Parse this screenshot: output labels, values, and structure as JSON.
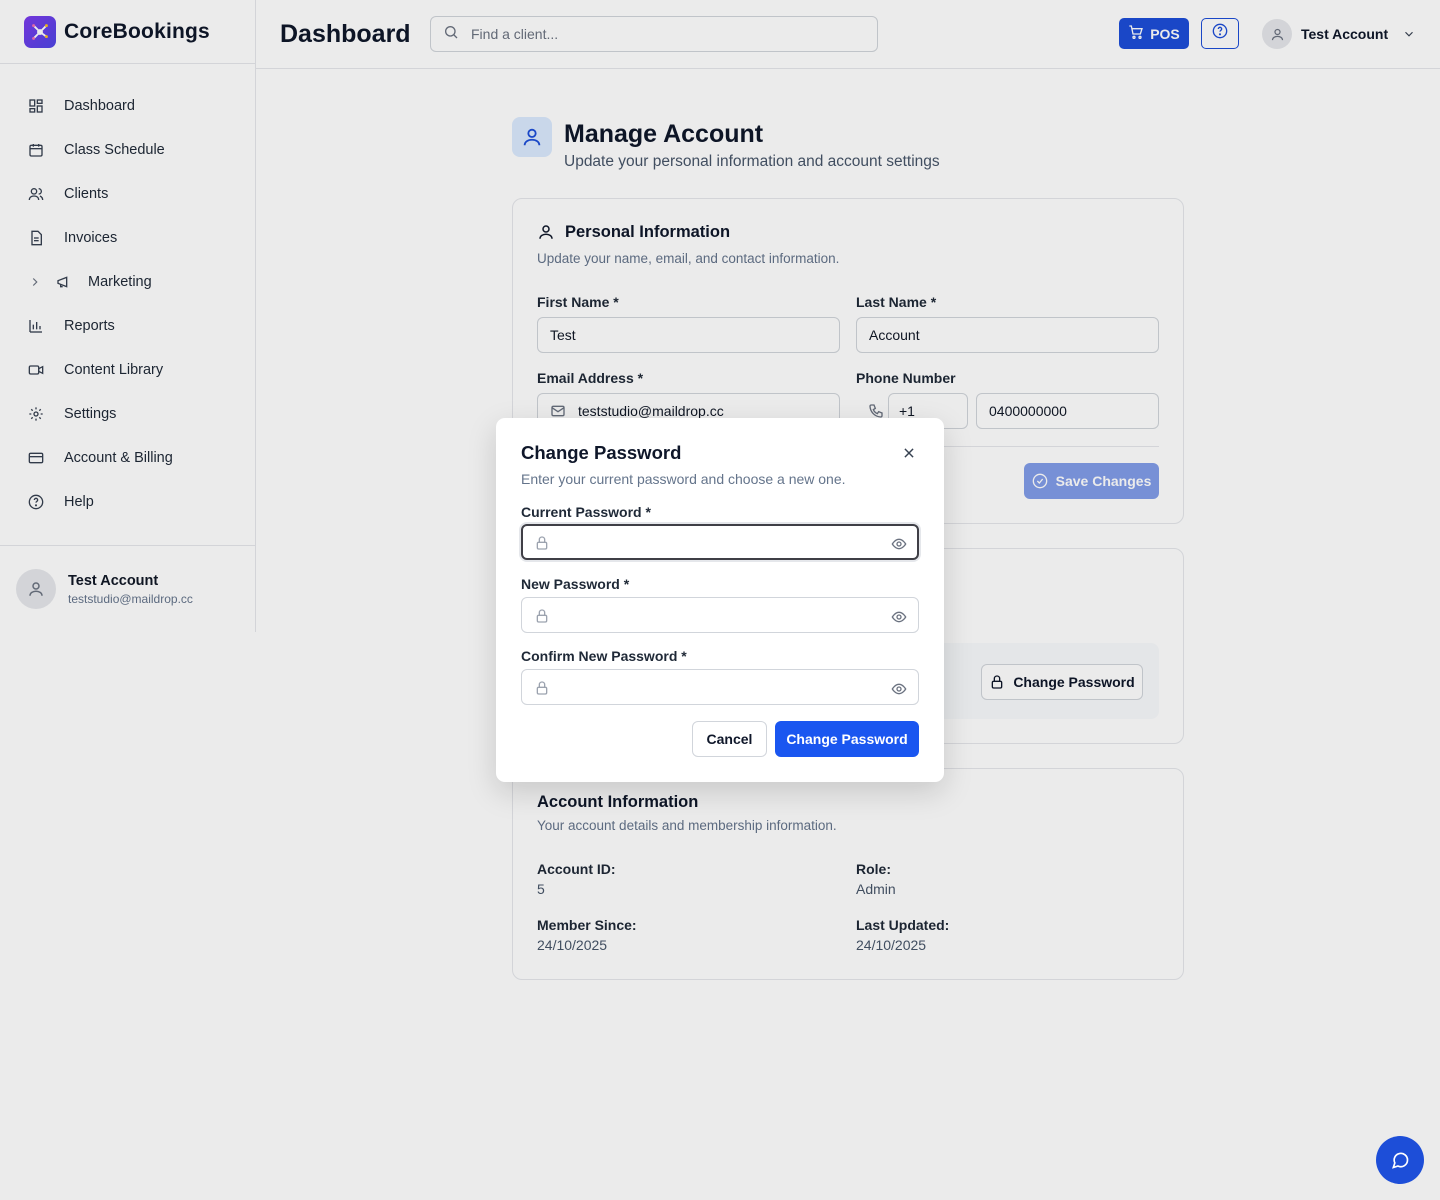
{
  "brand": {
    "name": "CoreBookings"
  },
  "sidebar": {
    "items": [
      {
        "label": "Dashboard",
        "icon": "dashboard-grid-icon"
      },
      {
        "label": "Class Schedule",
        "icon": "calendar-icon"
      },
      {
        "label": "Clients",
        "icon": "users-icon"
      },
      {
        "label": "Invoices",
        "icon": "document-icon"
      },
      {
        "label": "Marketing",
        "icon": "megaphone-icon"
      },
      {
        "label": "Reports",
        "icon": "bar-chart-icon"
      },
      {
        "label": "Content Library",
        "icon": "video-icon"
      },
      {
        "label": "Settings",
        "icon": "gear-icon"
      },
      {
        "label": "Account & Billing",
        "icon": "credit-card-icon"
      },
      {
        "label": "Help",
        "icon": "help-circle-icon"
      }
    ],
    "user": {
      "name": "Test Account",
      "email": "teststudio@maildrop.cc"
    }
  },
  "header": {
    "title": "Dashboard",
    "search_placeholder": "Find a client...",
    "pos_label": "POS",
    "account_name": "Test Account"
  },
  "page": {
    "title": "Manage Account",
    "subtitle": "Update your personal information and account settings"
  },
  "personal": {
    "title": "Personal Information",
    "description": "Update your name, email, and contact information.",
    "first_name_label": "First Name *",
    "first_name_value": "Test",
    "last_name_label": "Last Name *",
    "last_name_value": "Account",
    "email_label": "Email Address *",
    "email_value": "teststudio@maildrop.cc",
    "phone_label": "Phone Number",
    "phone_code": "+1",
    "phone_value": "0400000000",
    "save_label": "Save Changes"
  },
  "security": {
    "change_password_label": "Change Password"
  },
  "account_info": {
    "title": "Account Information",
    "description": "Your account details and membership information.",
    "account_id_label": "Account ID:",
    "account_id_value": "5",
    "role_label": "Role:",
    "role_value": "Admin",
    "member_since_label": "Member Since:",
    "member_since_value": "24/10/2025",
    "last_updated_label": "Last Updated:",
    "last_updated_value": "24/10/2025"
  },
  "modal": {
    "title": "Change Password",
    "description": "Enter your current password and choose a new one.",
    "current_label": "Current Password *",
    "new_label": "New Password *",
    "confirm_label": "Confirm New Password *",
    "cancel_label": "Cancel",
    "submit_label": "Change Password"
  },
  "colors": {
    "primary": "#1a56f0",
    "brand_gradient_start": "#7c3aed",
    "brand_gradient_end": "#4f46e5"
  }
}
